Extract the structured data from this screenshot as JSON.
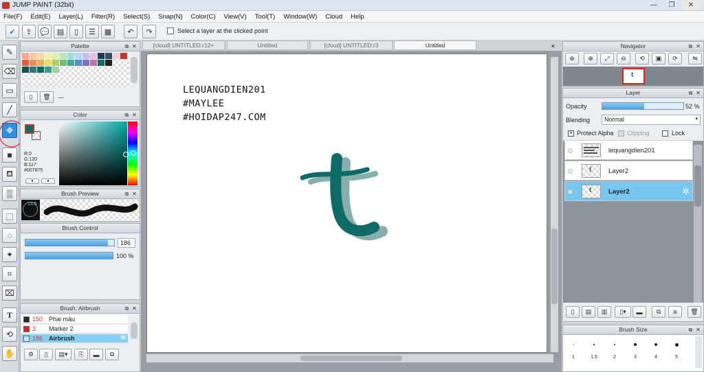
{
  "app": {
    "title": "JUMP PAINT (32bit)"
  },
  "menu": [
    "File(F)",
    "Edit(E)",
    "Layer(L)",
    "Filter(R)",
    "Select(S)",
    "Snap(N)",
    "Color(C)",
    "View(V)",
    "Tool(T)",
    "Window(W)",
    "Cloud",
    "Help"
  ],
  "toolbar": {
    "select_layer_label": "Select a layer at the clicked point"
  },
  "tabs": [
    {
      "label": "[cloud] UNTITLED:r12+",
      "active": false
    },
    {
      "label": "Untitled",
      "active": false
    },
    {
      "label": "[cloud] UNTITLED:r3",
      "active": false
    },
    {
      "label": "Untitled",
      "active": true
    }
  ],
  "canvas": {
    "text_lines": [
      "LEQUANGDIEN201",
      "#MAYLEE",
      "#HOIDAP247.COM"
    ],
    "letter_color": "#0f6b68"
  },
  "palette": {
    "title": "Palette",
    "footer_text": "---",
    "swatches": [
      "#f4a98a",
      "#f7c8a8",
      "#f7d8b0",
      "#f6f0b0",
      "#e0f0b0",
      "#b8e8c0",
      "#a0dcd8",
      "#b8d8f0",
      "#c8c0ec",
      "#e8c0e0",
      "#1f3a5a",
      "#2d4e66",
      "#f9d2cc",
      "#c0392b",
      "#e0603e",
      "#f08a52",
      "#f0b050",
      "#e8e060",
      "#b0d060",
      "#70c070",
      "#40a8a0",
      "#5090d0",
      "#8070c0",
      "#c070b0",
      "#0f6b68",
      "#222222",
      "",
      "",
      "#1c4e4c",
      "#2c7a78",
      "#0f6b68",
      "#3e9c8c",
      "#9ed4a4",
      "",
      "",
      "",
      "",
      "",
      "",
      "",
      "",
      ""
    ]
  },
  "color": {
    "title": "Color",
    "r_label": "R:0",
    "g_label": "G:120",
    "b_label": "B:117",
    "hex": "#007875",
    "current": "#0f6b68"
  },
  "brush_preview": {
    "title": "Brush Preview",
    "size": "13.5"
  },
  "brush_control": {
    "title": "Brush Control",
    "size_value": "186",
    "opacity_value": "100 %",
    "size_fraction": 0.93,
    "opacity_fraction": 1.0
  },
  "brush_list": {
    "title": "Brush: Airbrush",
    "items": [
      {
        "num": "150",
        "name": "Phai màu",
        "color": "#2b2b2b",
        "selected": false
      },
      {
        "num": "3",
        "name": "Marker 2",
        "color": "#e02020",
        "selected": false
      },
      {
        "num": "186",
        "name": "Airbrush",
        "color": "#c8e8f8",
        "selected": true
      }
    ]
  },
  "navigator": {
    "title": "Navigator"
  },
  "layer_panel": {
    "title": "Layer",
    "opacity_label": "Opacity",
    "opacity_value": "52 %",
    "opacity_fraction": 0.52,
    "blending_label": "Blending",
    "blending_value": "Normal",
    "protect_alpha": "Protect Alpha",
    "clipping": "Clipping",
    "lock": "Lock",
    "layers": [
      {
        "name": "lequangdien201",
        "selected": false
      },
      {
        "name": "Layer2",
        "selected": false
      },
      {
        "name": "Layer2",
        "selected": true
      }
    ]
  },
  "brush_size": {
    "title": "Brush Size",
    "sizes": [
      "1",
      "1.5",
      "2",
      "3",
      "4",
      "5"
    ]
  }
}
